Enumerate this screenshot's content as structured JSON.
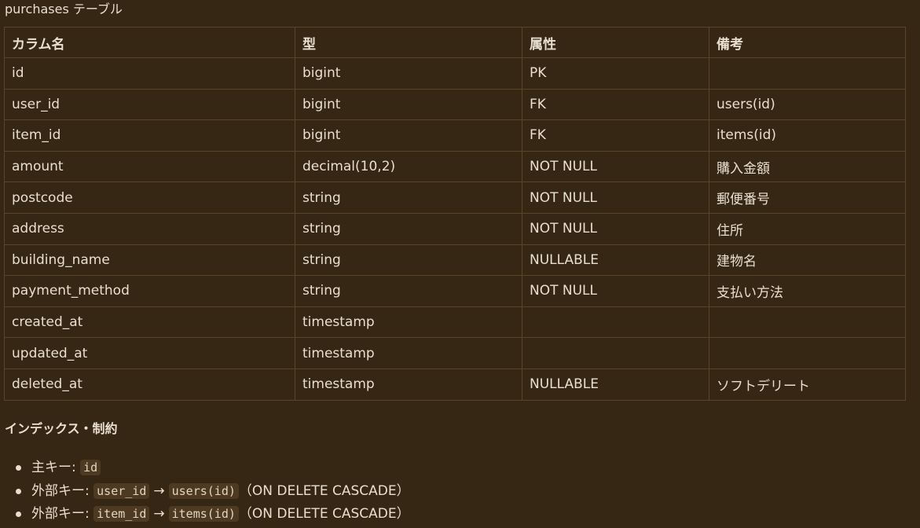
{
  "title": "purchases テーブル",
  "table": {
    "headers": [
      "カラム名",
      "型",
      "属性",
      "備考"
    ],
    "rows": [
      [
        "id",
        "bigint",
        "PK",
        ""
      ],
      [
        "user_id",
        "bigint",
        "FK",
        "users(id)"
      ],
      [
        "item_id",
        "bigint",
        "FK",
        "items(id)"
      ],
      [
        "amount",
        "decimal(10,2)",
        "NOT NULL",
        "購入金額"
      ],
      [
        "postcode",
        "string",
        "NOT NULL",
        "郵便番号"
      ],
      [
        "address",
        "string",
        "NOT NULL",
        "住所"
      ],
      [
        "building_name",
        "string",
        "NULLABLE",
        "建物名"
      ],
      [
        "payment_method",
        "string",
        "NOT NULL",
        "支払い方法"
      ],
      [
        "created_at",
        "timestamp",
        "",
        ""
      ],
      [
        "updated_at",
        "timestamp",
        "",
        ""
      ],
      [
        "deleted_at",
        "timestamp",
        "NULLABLE",
        "ソフトデリート"
      ]
    ]
  },
  "constraints": {
    "heading": "インデックス・制約",
    "items": [
      {
        "label": "主キー: ",
        "code1": "id"
      },
      {
        "label": "外部キー: ",
        "code1": "user_id",
        "arrow": "→",
        "code2": "users(id)",
        "suffix": "（ON DELETE CASCADE）"
      },
      {
        "label": "外部キー: ",
        "code1": "item_id",
        "arrow": "→",
        "code2": "items(id)",
        "suffix": "（ON DELETE CASCADE）"
      }
    ]
  }
}
